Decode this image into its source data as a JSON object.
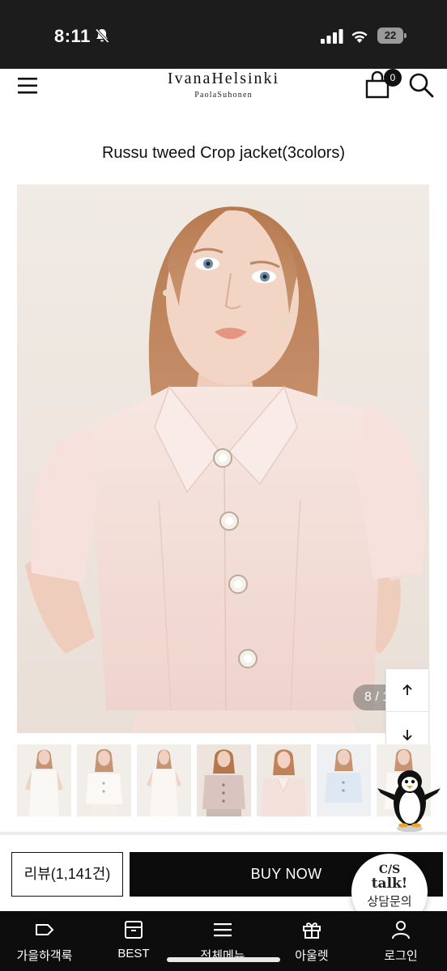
{
  "status_bar": {
    "time": "8:11",
    "battery_level": "22",
    "icons": [
      "bell-off-icon",
      "signal-icon",
      "wifi-icon",
      "battery-icon"
    ]
  },
  "header": {
    "logo_main": "IvanaHelsinki",
    "logo_sub": "PaolaSuhonen",
    "cart_count": "0",
    "icons": [
      "menu-icon",
      "cart-icon",
      "search-icon"
    ]
  },
  "product": {
    "title": "Russu tweed Crop jacket(3colors)",
    "image_counter": "8 / 1"
  },
  "thumbnails": [
    {
      "tone": "white dress"
    },
    {
      "tone": "white jacket"
    },
    {
      "tone": "white dress"
    },
    {
      "tone": "pink jacket"
    },
    {
      "tone": "pink jacket"
    },
    {
      "tone": "blue jacket"
    },
    {
      "tone": "white jacket"
    }
  ],
  "actions": {
    "review_label": "리뷰(1,141건)",
    "buy_label": "BUY NOW"
  },
  "cs_talk": {
    "top": "C/S",
    "mid": "talk!",
    "bottom": "상담문의"
  },
  "bottom_nav": {
    "items": [
      {
        "label": "가을하객룩",
        "icon": "tag-icon"
      },
      {
        "label": "BEST",
        "icon": "archive-box-icon"
      },
      {
        "label": "전체메뉴",
        "icon": "hamburger-icon"
      },
      {
        "label": "아울렛",
        "icon": "gift-icon"
      },
      {
        "label": "로그인",
        "icon": "person-icon"
      }
    ]
  },
  "colors": {
    "status_bar_bg": "#1c1c1c",
    "buy_button_bg": "#0c0c0c",
    "nav_bg": "#0d0d0d",
    "jacket_pink": "#f4ddd8"
  }
}
